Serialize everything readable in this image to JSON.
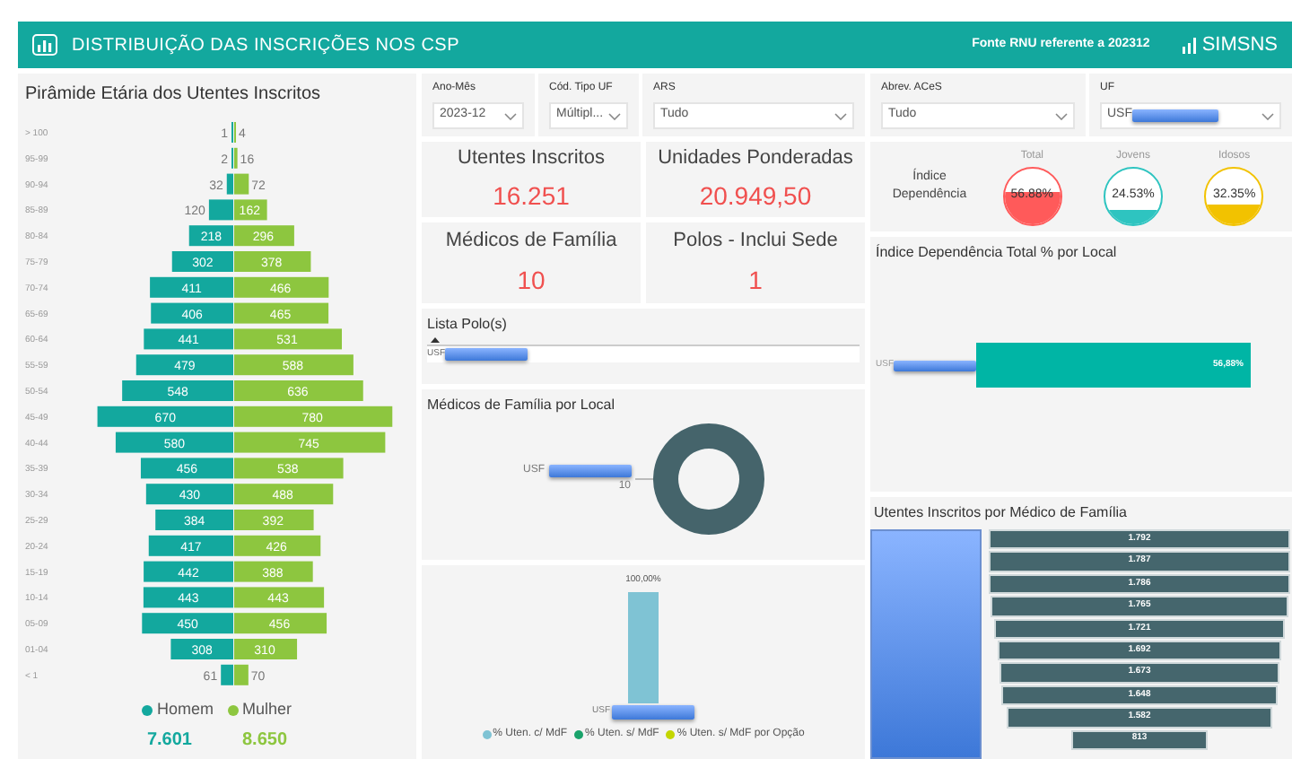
{
  "header": {
    "title": "DISTRIBUIÇÃO DAS INSCRIÇÕES NOS CSP",
    "source": "Fonte RNU referente a 202312",
    "logo": "SIMSNS"
  },
  "pyramid": {
    "title": "Pirâmide Etária dos Utentes Inscritos",
    "series": [
      {
        "name": "Homem",
        "color": "#13a89e"
      },
      {
        "name": "Mulher",
        "color": "#8dc63f"
      }
    ],
    "rows": [
      {
        "age": "> 100",
        "values": [
          "1",
          "4"
        ]
      },
      {
        "age": "95-99",
        "values": [
          "2",
          "16"
        ]
      },
      {
        "age": "90-94",
        "values": [
          "32",
          "72"
        ]
      },
      {
        "age": "85-89",
        "values": [
          "120",
          "162"
        ]
      },
      {
        "age": "80-84",
        "values": [
          "218",
          "296"
        ]
      },
      {
        "age": "75-79",
        "values": [
          "302",
          "378"
        ]
      },
      {
        "age": "70-74",
        "values": [
          "411",
          "466"
        ]
      },
      {
        "age": "65-69",
        "values": [
          "406",
          "465"
        ]
      },
      {
        "age": "60-64",
        "values": [
          "441",
          "531"
        ]
      },
      {
        "age": "55-59",
        "values": [
          "479",
          "588"
        ]
      },
      {
        "age": "50-54",
        "values": [
          "548",
          "636"
        ]
      },
      {
        "age": "45-49",
        "values": [
          "670",
          "780"
        ]
      },
      {
        "age": "40-44",
        "values": [
          "580",
          "745"
        ]
      },
      {
        "age": "35-39",
        "values": [
          "456",
          "538"
        ]
      },
      {
        "age": "30-34",
        "values": [
          "430",
          "488"
        ]
      },
      {
        "age": "25-29",
        "values": [
          "384",
          "392"
        ]
      },
      {
        "age": "20-24",
        "values": [
          "417",
          "426"
        ]
      },
      {
        "age": "15-19",
        "values": [
          "442",
          "388"
        ]
      },
      {
        "age": "10-14",
        "values": [
          "443",
          "443"
        ]
      },
      {
        "age": "05-09",
        "values": [
          "450",
          "456"
        ]
      },
      {
        "age": "01-04",
        "values": [
          "308",
          "310"
        ]
      },
      {
        "age": "< 1",
        "values": [
          "61",
          "70"
        ]
      }
    ],
    "totals": [
      "7.601",
      "8.650"
    ]
  },
  "filters": [
    {
      "label": "Ano-Mês",
      "value": "2023-12"
    },
    {
      "label": "Cód. Tipo UF",
      "value": "Múltipl..."
    },
    {
      "label": "ARS",
      "value": "Tudo"
    },
    {
      "label": "Abrev. ACeS",
      "value": "Tudo"
    },
    {
      "label": "UF",
      "value": "USF"
    }
  ],
  "kpis": [
    {
      "label": "Utentes Inscritos",
      "value": "16.251"
    },
    {
      "label": "Unidades Ponderadas",
      "value": "20.949,50"
    },
    {
      "label": "Médicos de Família",
      "value": "10"
    },
    {
      "label": "Polos - Inclui Sede",
      "value": "1"
    }
  ],
  "dependency": {
    "label": "Índice Dependência",
    "gauges": [
      {
        "name": "Total",
        "value": "56.88%",
        "color": "#ff5a5a"
      },
      {
        "name": "Jovens",
        "value": "24.53%",
        "color": "#2ec4c0"
      },
      {
        "name": "Idosos",
        "value": "32.35%",
        "color": "#f2c200"
      }
    ]
  },
  "polo_list": {
    "title": "Lista Polo(s)",
    "items": [
      {
        "label": "USF"
      }
    ]
  },
  "doctors_by_local": {
    "title": "Médicos de Família por Local",
    "slices": [
      {
        "label": "USF",
        "value": "10",
        "color": "#45646b"
      }
    ]
  },
  "coverage": {
    "bars": [
      {
        "label": "USF",
        "value": "100,00%",
        "color": "#7fc3d4"
      }
    ],
    "legend": [
      {
        "name": "% Uten. c/ MdF",
        "color": "#7fc3d4"
      },
      {
        "name": "% Uten. s/ MdF",
        "color": "#1aa36b"
      },
      {
        "name": "% Uten. s/ MdF por Opção",
        "color": "#c4d600"
      }
    ]
  },
  "dep_by_local": {
    "title": "Índice Dependência Total % por Local",
    "bars": [
      {
        "label": "USF",
        "value": "56,88%"
      }
    ]
  },
  "funnel": {
    "title": "Utentes Inscritos por Médico de Família",
    "bars": [
      "1.792",
      "1.787",
      "1.786",
      "1.765",
      "1.721",
      "1.692",
      "1.673",
      "1.648",
      "1.582",
      "813"
    ]
  }
}
